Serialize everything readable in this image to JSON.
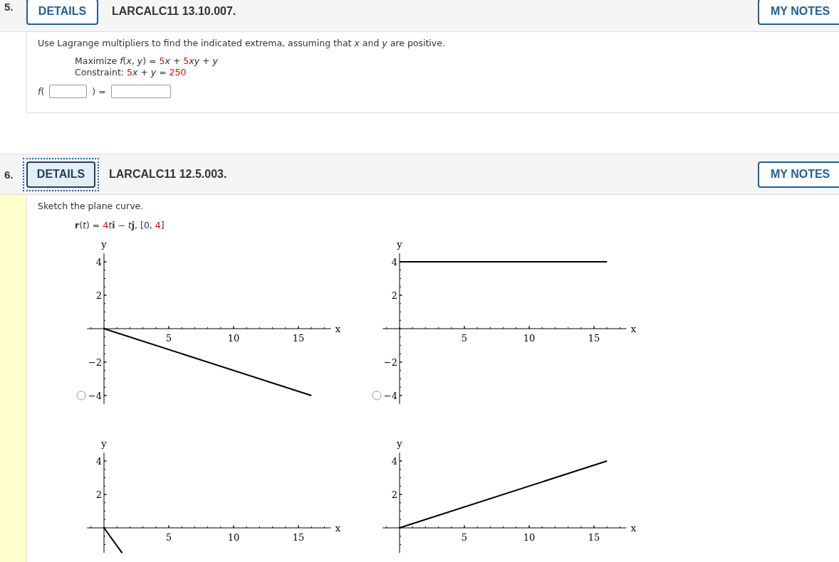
{
  "questions": [
    {
      "number": "5.",
      "details": {
        "label": "DETAILS",
        "focused": false
      },
      "title": "LARCALC11 13.10.007.",
      "notes": "MY NOTES",
      "current": false,
      "prompt": "Use Lagrange multipliers to find the indicated extrema, assuming that *x* and *y* are positive.",
      "formulas": [
        [
          {
            "text": "Maximize *f*(*x*, *y*) = ",
            "highlight": false
          },
          {
            "text": "5",
            "highlight": true
          },
          {
            "text": "*x* + ",
            "highlight": false
          },
          {
            "text": "5",
            "highlight": true
          },
          {
            "text": "*xy* + *y*",
            "highlight": false
          }
        ],
        [
          {
            "text": "Constraint: ",
            "highlight": false
          },
          {
            "text": "5",
            "highlight": true
          },
          {
            "text": "*x* + *y* = ",
            "highlight": false
          },
          {
            "text": "250",
            "highlight": true
          }
        ]
      ],
      "answer": {
        "prefix": "*f*(",
        "middle": ") ="
      }
    },
    {
      "number": "6.",
      "details": {
        "label": "DETAILS",
        "focused": true
      },
      "title": "LARCALC11 12.5.003.",
      "notes": "MY NOTES",
      "current": true,
      "prompt": "Sketch the plane curve.",
      "formulas": [
        [
          {
            "text": "**r**(*t*) = ",
            "highlight": false
          },
          {
            "text": "4",
            "highlight": true
          },
          {
            "text": "*t*",
            "highlight": false
          },
          {
            "text": "**i** − ",
            "highlight": false
          },
          {
            "text": "*t*",
            "highlight": false
          },
          {
            "text": "**j**,  [0, ",
            "highlight": false
          },
          {
            "text": "4",
            "highlight": true
          },
          {
            "text": "]",
            "highlight": false
          }
        ]
      ],
      "options": [
        {
          "selected": false,
          "chart_data": {
            "type": "line",
            "xlabel": "x",
            "ylabel": "y",
            "xlim": [
              -1.3,
              17.5
            ],
            "ylim": [
              -4.5,
              4.5
            ],
            "xticks": [
              5,
              10,
              15
            ],
            "yticks": [
              -4,
              -2,
              2,
              4
            ],
            "x": [
              0,
              16
            ],
            "series": [
              {
                "color": "#000000",
                "values": [
                  0,
                  -4
                ]
              }
            ]
          }
        },
        {
          "selected": false,
          "chart_data": {
            "type": "line",
            "xlabel": "x",
            "ylabel": "y",
            "xlim": [
              -1.3,
              17.5
            ],
            "ylim": [
              -4.5,
              4.5
            ],
            "xticks": [
              5,
              10,
              15
            ],
            "yticks": [
              -4,
              -2,
              2,
              4
            ],
            "x": [
              0,
              16
            ],
            "series": [
              {
                "color": "#000000",
                "values": [
                  4,
                  4
                ]
              }
            ]
          }
        },
        {
          "chart_data": {
            "type": "line",
            "xlabel": "x",
            "ylabel": "y",
            "xlim": [
              -1.3,
              17.5
            ],
            "ylim": [
              -1.5,
              4.5
            ],
            "xticks": [
              5,
              10,
              15
            ],
            "yticks": [
              2,
              4
            ],
            "x": [
              0,
              1.4
            ],
            "series": [
              {
                "color": "#000000",
                "values": [
                  0,
                  -1.5
                ]
              }
            ]
          }
        },
        {
          "chart_data": {
            "type": "line",
            "xlabel": "x",
            "ylabel": "y",
            "xlim": [
              -1.3,
              17.5
            ],
            "ylim": [
              -1.5,
              4.5
            ],
            "xticks": [
              5,
              10,
              15
            ],
            "yticks": [
              2,
              4
            ],
            "x": [
              0,
              16
            ],
            "series": [
              {
                "color": "#000000",
                "values": [
                  0,
                  4
                ]
              }
            ]
          }
        }
      ]
    }
  ]
}
